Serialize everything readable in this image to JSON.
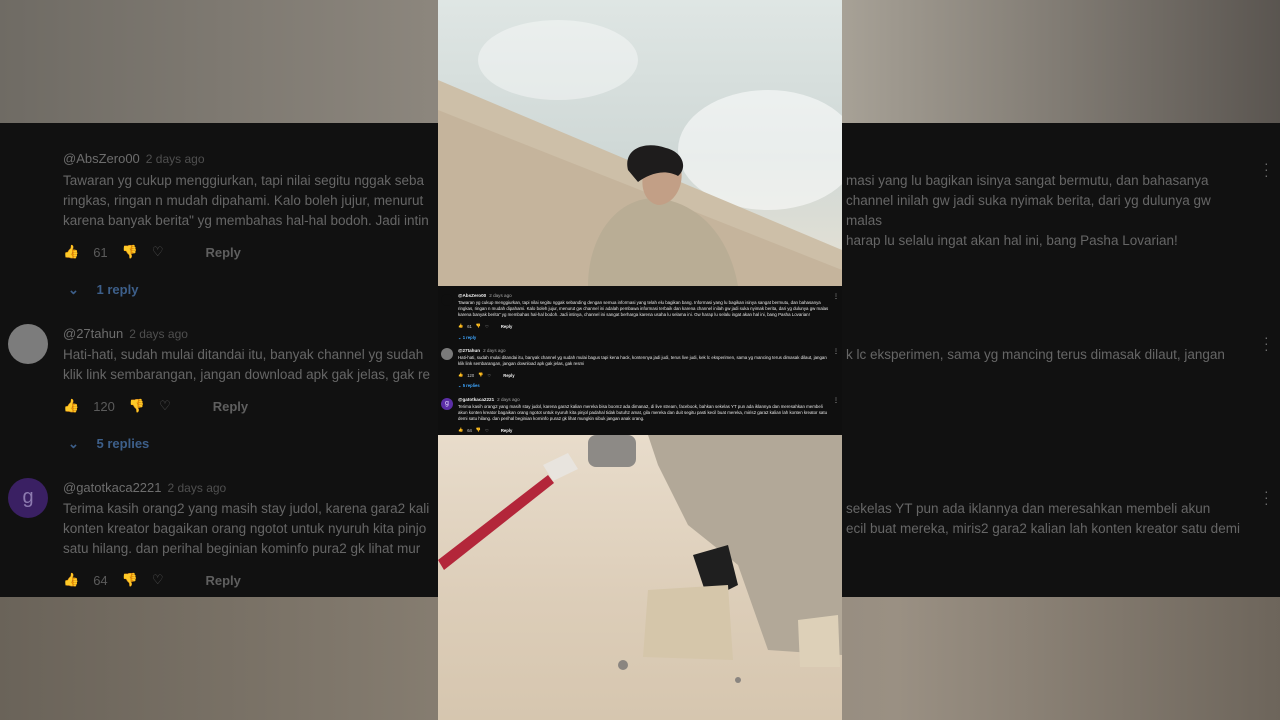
{
  "comments": [
    {
      "user": "@AbsZero00",
      "time": "2 days ago",
      "text": "Tawaran yg cukup menggiurkan, tapi nilai segitu nggak sebanding dengan semua informasi yang telah elu bagikan bang. Informasi yang lu bagikan isinya sangat bermutu, dan bahasanya ringkas, ringan n mudah dipahami. Kalo boleh jujur, menurut gw channel ini adalah pembawa informasi terbaik dan karena channel inilah gw jadi suka nyimak berita, dari yg dulunya gw malas karena banyak berita\" yg membahas hal-hal bodoh. Jadi intinya, channel ini sangat berharga karena usaha lu selama ini. Gw harap lu selalu ingat akan hal ini, bang Pasha Lovarian!",
      "likes": "61",
      "reply_label": "Reply",
      "replies": "1 reply",
      "avatar_color": "#0f0f0f"
    },
    {
      "user": "@27tahun",
      "time": "2 days ago",
      "text": "Hati-hati, sudah mulai ditandai itu, banyak channel yg sudah mulai bagus tapi kena hack, kontennya jadi judi, terus live judi, kek lc eksperimen, sama yg mancing terus dimasak dilaut, jangan klik link sembarangan, jangan download apk gak jelas, gak resmi",
      "likes": "120",
      "reply_label": "Reply",
      "replies": "5 replies",
      "avatar_color": "#7a7a7a"
    },
    {
      "user": "@gatotkaca2221",
      "time": "2 days ago",
      "text": "Terima kasih orang2 yang masih stay judol, karena gara2 kalian mereka bisa boom2 ada dimana2, di live stream, facebook, bahkan sekelas YT pun ada iklannya dan meresahkan membeli akun konten kreator bagaikan orang ngotot untuk nyuruh kita pinjol padahal tidak butuh2 amat, gila mereka dan duit segitu pasti kecil buat mereka, miris2 gara2 kalian lah konten kreator satu demi satu hilang. dan perihal beginian kominfo pura2 gk lihat mungkin sibuk jangan anak orang.",
      "likes": "64",
      "reply_label": "Reply",
      "avatar_letter": "g",
      "avatar_color": "#5b2ea6"
    }
  ],
  "blurred": {
    "c1_user": "@AbsZero00",
    "c1_time": "2 days ago",
    "c1_text_left": "Tawaran yg cukup menggiurkan, tapi nilai segitu nggak seba",
    "c1_text_left2": "ringkas, ringan n mudah dipahami. Kalo boleh jujur, menurut",
    "c1_text_left3": "karena banyak berita\" yg membahas hal-hal bodoh. Jadi intin",
    "c1_text_right": "masi yang lu bagikan isinya sangat bermutu, dan bahasanya",
    "c1_text_right2": "channel inilah gw jadi suka nyimak berita, dari yg dulunya gw malas",
    "c1_text_right3": "harap lu selalu ingat akan hal ini, bang Pasha Lovarian!",
    "c1_likes": "61",
    "c1_reply": "Reply",
    "c1_replies": "1 reply",
    "c2_user": "@27tahun",
    "c2_time": "2 days ago",
    "c2_text_left": "Hati-hati, sudah mulai ditandai itu, banyak channel yg sudah",
    "c2_text_left2": "klik link sembarangan, jangan download apk gak jelas, gak re",
    "c2_text_right": "k lc eksperimen, sama yg mancing terus dimasak dilaut, jangan",
    "c2_likes": "120",
    "c2_reply": "Reply",
    "c2_replies": "5 replies",
    "c3_user": "@gatotkaca2221",
    "c3_time": "2 days ago",
    "c3_avatar": "g",
    "c3_text_left": "Terima kasih orang2 yang masih stay judol, karena gara2 kali",
    "c3_text_left2": "konten kreator bagaikan orang ngotot untuk nyuruh kita pinjo",
    "c3_text_left3": "satu hilang. dan perihal beginian kominfo pura2 gk lihat mur",
    "c3_text_right": "sekelas YT pun ada iklannya dan meresahkan membeli akun",
    "c3_text_right2": "ecil buat mereka, miris2 gara2 kalian lah konten kreator satu demi",
    "c3_likes": "64",
    "c3_reply": "Reply"
  },
  "icons": [
    "thumbs-up-icon",
    "thumbs-down-icon",
    "heart-icon",
    "chevron-down-icon",
    "kebab-menu-icon"
  ],
  "colors": {
    "panel_bg": "#0f0f0f",
    "link_blue": "#3ea6ff",
    "text_white": "#f1f1f1"
  }
}
